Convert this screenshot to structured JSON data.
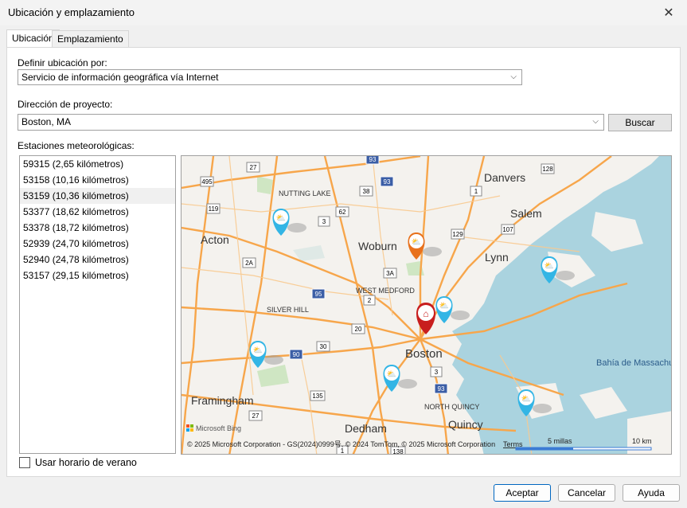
{
  "window": {
    "title": "Ubicación y emplazamiento"
  },
  "tabs": [
    {
      "label": "Ubicación"
    },
    {
      "label": "Emplazamiento"
    }
  ],
  "location": {
    "define_label": "Definir ubicación por:",
    "define_value": "Servicio de información geográfica vía Internet",
    "address_label": "Dirección de proyecto:",
    "address_value": "Boston, MA",
    "search_button": "Buscar",
    "stations_label": "Estaciones meteorológicas:"
  },
  "stations": [
    "59315 (2,65 kilómetros)",
    "53158 (10,16 kilómetros)",
    "53159 (10,36 kilómetros)",
    "53377 (18,62 kilómetros)",
    "53378 (18,72 kilómetros)",
    "52939 (24,70 kilómetros)",
    "52940 (24,78 kilómetros)",
    "53157 (29,15 kilómetros)"
  ],
  "map": {
    "places": {
      "danvers": "Danvers",
      "salem": "Salem",
      "lynn": "Lynn",
      "acton": "Acton",
      "woburn": "Woburn",
      "nutting_lake": "NUTTING LAKE",
      "west_medford": "WEST MEDFORD",
      "silver_hill": "SILVER HILL",
      "boston": "Boston",
      "framingham": "Framingham",
      "dedham": "Dedham",
      "quincy": "Quincy",
      "north_quincy": "NORTH QUINCY",
      "bay": "Bahía de Massachu"
    },
    "routes": [
      "495",
      "27",
      "93",
      "128",
      "38",
      "93",
      "1",
      "119",
      "62",
      "3",
      "107",
      "2A",
      "129",
      "3A",
      "95",
      "2",
      "20",
      "90",
      "30",
      "3",
      "135",
      "93",
      "27",
      "1",
      "138"
    ],
    "attribution": "© 2025 Microsoft Corporation - GS(2024)0999号, © 2024 TomTom, © 2025 Microsoft Corporation",
    "terms": "Terms",
    "logo": "Microsoft Bing",
    "scale_miles": "5 millas",
    "scale_km": "10 km"
  },
  "dst": {
    "label": "Usar horario de verano"
  },
  "footer": {
    "ok": "Aceptar",
    "cancel": "Cancelar",
    "help": "Ayuda"
  },
  "colors": {
    "accent": "#0067c0",
    "water": "#aad3df",
    "road": "#f7a64b",
    "station": "#33b5e5",
    "home": "#c81e1e",
    "selected_station": "#e8711c"
  }
}
